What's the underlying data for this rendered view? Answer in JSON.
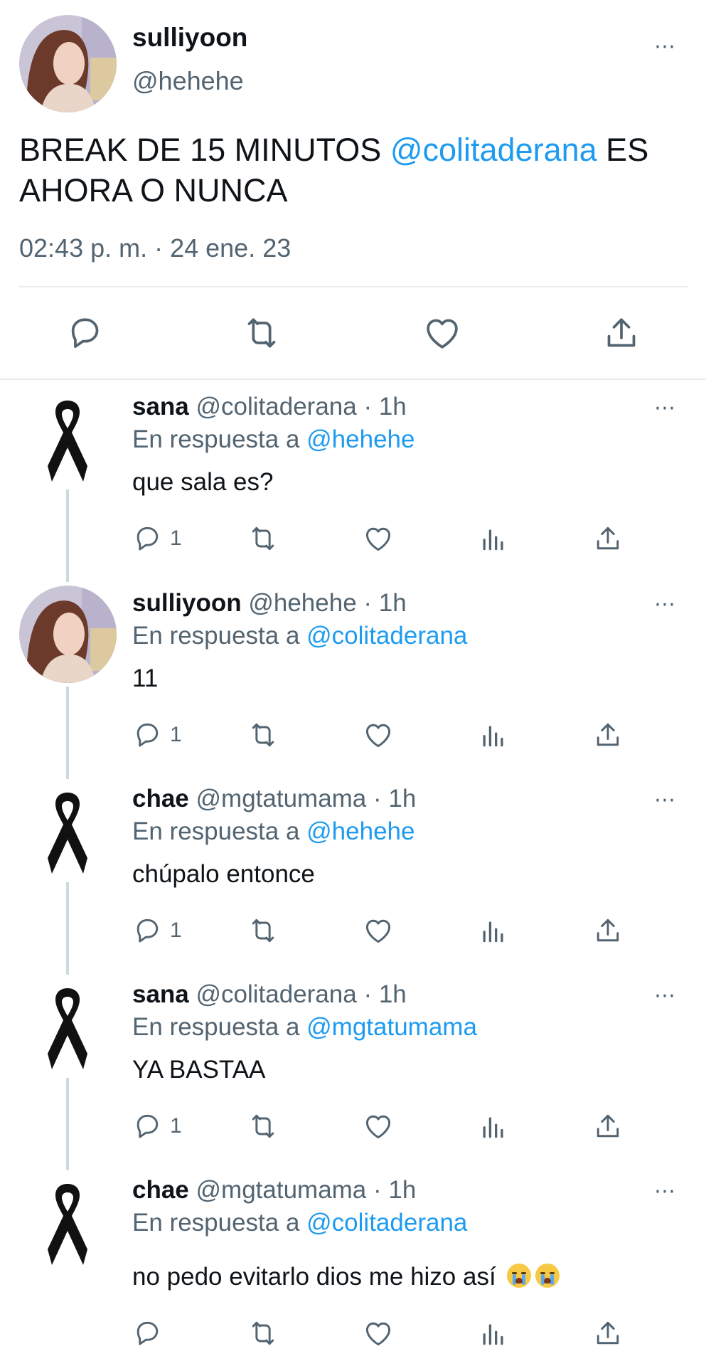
{
  "main_tweet": {
    "name": "sulliyoon",
    "handle": "@hehehe",
    "text_before": "BREAK DE 15 MINUTOS ",
    "mention": "@colitaderana",
    "text_after": " ES AHORA O NUNCA",
    "timestamp": "02:43 p. m. · 24 ene. 23",
    "more_icon": "⋯"
  },
  "replies": [
    {
      "name": "sana",
      "meta": " @colitaderana · 1h",
      "reply_prefix": "En respuesta a ",
      "reply_mention": "@hehehe",
      "text": "que sala es?",
      "reply_count": "1",
      "avatar": "black-ribbon-icon"
    },
    {
      "name": "sulliyoon",
      "meta": " @hehehe · 1h",
      "reply_prefix": "En respuesta a ",
      "reply_mention": "@colitaderana",
      "text": "11",
      "reply_count": "1",
      "avatar": "profile-photo"
    },
    {
      "name": "chae",
      "meta": " @mgtatumama · 1h",
      "reply_prefix": "En respuesta a ",
      "reply_mention": "@hehehe",
      "text": "chúpalo entonce",
      "reply_count": "1",
      "avatar": "black-ribbon-icon"
    },
    {
      "name": "sana",
      "meta": " @colitaderana · 1h",
      "reply_prefix": "En respuesta a ",
      "reply_mention": "@mgtatumama",
      "text": "YA BASTAA",
      "reply_count": "1",
      "avatar": "black-ribbon-icon"
    },
    {
      "name": "chae",
      "meta": " @mgtatumama · 1h",
      "reply_prefix": "En respuesta a ",
      "reply_mention": "@colitaderana",
      "text": "no pedo evitarlo dios me hizo así",
      "reply_count": "",
      "avatar": "black-ribbon-icon",
      "emojis": [
        "crying-face",
        "crying-face"
      ]
    }
  ],
  "colors": {
    "link": "#1d9bf0",
    "secondary_text": "#536471",
    "divider": "#e6ecf0"
  }
}
